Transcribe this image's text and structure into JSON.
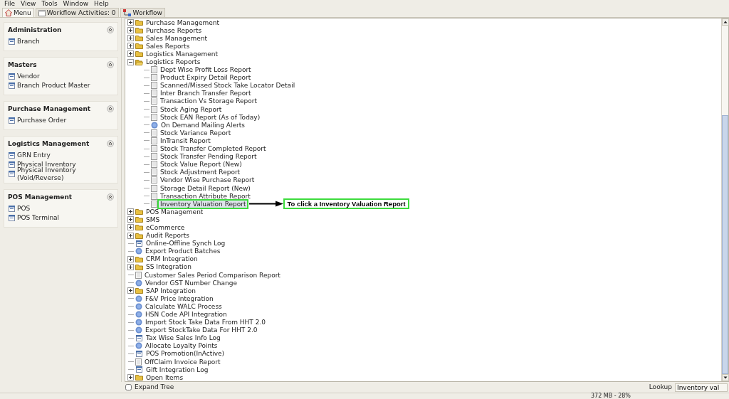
{
  "menubar": [
    "File",
    "View",
    "Tools",
    "Window",
    "Help"
  ],
  "tabs": [
    {
      "label": "Menu",
      "kind": "home",
      "selected": true
    },
    {
      "label": "Workflow Activities: 0",
      "kind": "calendar",
      "selected": false
    },
    {
      "label": "Workflow",
      "kind": "flow",
      "selected": false
    }
  ],
  "sidebar": {
    "sections": [
      {
        "title": "Administration",
        "expanded": true,
        "items": [
          "Branch"
        ]
      },
      {
        "title": "Masters",
        "expanded": true,
        "items": [
          "Vendor",
          "Branch Product Master"
        ]
      },
      {
        "title": "Purchase Management",
        "expanded": true,
        "items": [
          "Purchase Order"
        ]
      },
      {
        "title": "Logistics Management",
        "expanded": true,
        "items": [
          "GRN Entry",
          "Physical Inventory",
          "Physical Inventory (Void/Reverse)"
        ]
      },
      {
        "title": "POS Management",
        "expanded": true,
        "items": [
          "POS",
          "POS Terminal"
        ]
      }
    ]
  },
  "tree": [
    {
      "label": "Purchase Management",
      "kind": "folder",
      "expanded": false,
      "selected": false
    },
    {
      "label": "Purchase Reports",
      "kind": "folder",
      "expanded": false,
      "selected": false
    },
    {
      "label": "Sales Management",
      "kind": "folder",
      "expanded": false,
      "selected": false
    },
    {
      "label": "Sales Reports",
      "kind": "folder",
      "expanded": false,
      "selected": false
    },
    {
      "label": "Logistics Management",
      "kind": "folder",
      "expanded": false,
      "selected": false
    },
    {
      "label": "Logistics Reports",
      "kind": "folder",
      "expanded": true,
      "selected": false,
      "children": [
        {
          "label": "Dept Wise Profit Loss Report",
          "kind": "report",
          "selected": false
        },
        {
          "label": "Product Expiry Detail Report",
          "kind": "report",
          "selected": false
        },
        {
          "label": "Scanned/Missed Stock Take Locator Detail",
          "kind": "report",
          "selected": false
        },
        {
          "label": "Inter Branch Transfer Report",
          "kind": "report",
          "selected": false
        },
        {
          "label": "Transaction Vs Storage Report",
          "kind": "report",
          "selected": false
        },
        {
          "label": "Stock Aging Report",
          "kind": "report",
          "selected": false
        },
        {
          "label": "Stock EAN Report (As of Today)",
          "kind": "report",
          "selected": false
        },
        {
          "label": "On Demand Mailing Alerts",
          "kind": "process",
          "selected": false
        },
        {
          "label": "Stock Variance Report",
          "kind": "report",
          "selected": false
        },
        {
          "label": "InTransit Report",
          "kind": "report",
          "selected": false
        },
        {
          "label": "Stock Transfer Completed Report",
          "kind": "report",
          "selected": false
        },
        {
          "label": "Stock Transfer Pending Report",
          "kind": "report",
          "selected": false
        },
        {
          "label": "Stock Value Report (New)",
          "kind": "report",
          "selected": false
        },
        {
          "label": "Stock Adjustment Report",
          "kind": "report",
          "selected": false
        },
        {
          "label": "Vendor Wise Purchase Report",
          "kind": "report",
          "selected": false
        },
        {
          "label": "Storage Detail Report (New)",
          "kind": "report",
          "selected": false
        },
        {
          "label": "Transaction Attribute Report",
          "kind": "report",
          "selected": false
        },
        {
          "label": "Inventory Valuation Report",
          "kind": "report",
          "selected": true,
          "annotation": "To click a Inventory Valuation Report"
        }
      ]
    },
    {
      "label": "POS Management",
      "kind": "folder",
      "expanded": false,
      "selected": false
    },
    {
      "label": "SMS",
      "kind": "folder",
      "expanded": false,
      "selected": false
    },
    {
      "label": "eCommerce",
      "kind": "folder",
      "expanded": false,
      "selected": false
    },
    {
      "label": "Audit Reports",
      "kind": "folder",
      "expanded": false,
      "selected": false
    },
    {
      "label": "Online-Offline Synch Log",
      "kind": "window",
      "selected": false
    },
    {
      "label": "Export Product Batches",
      "kind": "process",
      "selected": false
    },
    {
      "label": "CRM Integration",
      "kind": "folder",
      "expanded": false,
      "selected": false
    },
    {
      "label": "SS Integration",
      "kind": "folder",
      "expanded": false,
      "selected": false
    },
    {
      "label": "Customer Sales Period Comparison Report",
      "kind": "report",
      "selected": false
    },
    {
      "label": "Vendor GST Number Change",
      "kind": "process",
      "selected": false
    },
    {
      "label": "SAP Integration",
      "kind": "folder",
      "expanded": false,
      "selected": false
    },
    {
      "label": "F&V Price Integration",
      "kind": "process",
      "selected": false
    },
    {
      "label": "Calculate WALC Process",
      "kind": "process",
      "selected": false
    },
    {
      "label": "HSN Code API Integration",
      "kind": "process",
      "selected": false
    },
    {
      "label": "Import Stock Take Data From HHT 2.0",
      "kind": "process",
      "selected": false
    },
    {
      "label": "Export StockTake Data For HHT 2.0",
      "kind": "process",
      "selected": false
    },
    {
      "label": "Tax Wise Sales Info Log",
      "kind": "window",
      "selected": false
    },
    {
      "label": "Allocate Loyalty Points",
      "kind": "process",
      "selected": false
    },
    {
      "label": "POS Promotion(InActive)",
      "kind": "window",
      "selected": false
    },
    {
      "label": "OffClaim Invoice Report",
      "kind": "report",
      "selected": false
    },
    {
      "label": "Gift Integration Log",
      "kind": "window",
      "selected": false
    },
    {
      "label": "Open Items",
      "kind": "folder",
      "expanded": false,
      "selected": false
    }
  ],
  "expand_tree": {
    "label": "Expand Tree",
    "checked": false
  },
  "lookup": {
    "label": "Lookup",
    "value": "Inventory val"
  },
  "status_bar": {
    "memory": "372 MB - 28%"
  }
}
